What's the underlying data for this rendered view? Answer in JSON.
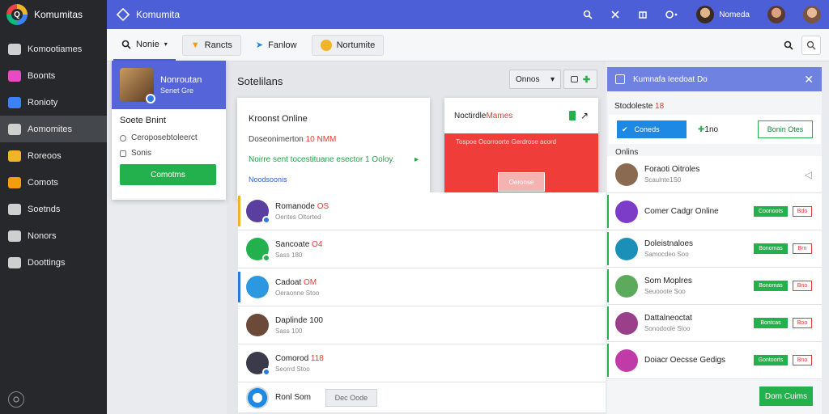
{
  "app": {
    "name": "Komumitas"
  },
  "sidebar": {
    "items": [
      {
        "label": "Komootiames",
        "icon": "home-icon",
        "color": "#cfcfcf"
      },
      {
        "label": "Boonts",
        "icon": "pink-app-icon",
        "color": "#e84bc1"
      },
      {
        "label": "Ronioty",
        "icon": "colorful-app-icon",
        "color": "#3b82f6"
      },
      {
        "label": "Aomomites",
        "icon": "list-icon",
        "color": "#cfcfcf"
      },
      {
        "label": "Roreoos",
        "icon": "colorful-app-icon",
        "color": "#f0b429"
      },
      {
        "label": "Comots",
        "icon": "colorful-app-icon",
        "color": "#f59e0b"
      },
      {
        "label": "Soetnds",
        "icon": "list-icon",
        "color": "#cfcfcf"
      },
      {
        "label": "Nonors",
        "icon": "circle-icon",
        "color": "#cfcfcf"
      },
      {
        "label": "Doottings",
        "icon": "gear-icon",
        "color": "#cfcfcf"
      }
    ],
    "active_index": 3
  },
  "topbar": {
    "title": "Komumita",
    "user_label": "Nomeda"
  },
  "tabs": [
    {
      "label": "Nonie",
      "icon": "search-icon"
    },
    {
      "label": "Rancts",
      "icon": "fox-icon"
    },
    {
      "label": "Fanlow",
      "icon": "bird-icon"
    },
    {
      "label": "Nortumite",
      "icon": "smile-icon"
    }
  ],
  "profile": {
    "name": "Nonroutan",
    "sub": "Senet Gre",
    "section_title": "Soete Bnint",
    "options": [
      "Ceroposebtoleerct",
      "Sonis"
    ],
    "button": "Comotms"
  },
  "main": {
    "title": "Sotelilans",
    "filter_value": "Onnos",
    "online_card": {
      "title": "Kroonst Online",
      "line_prefix": "Doseonimerton",
      "line_red": "10 NMM",
      "green_text": "Noirre sent tocestituane esector 1 Ooloy.",
      "blue_text": "Noodsoonis"
    },
    "notif_card": {
      "title_prefix": "Noctirdle",
      "title_red": "Mames",
      "sub": "Tospoe Ocorroorte Gerdrose acord",
      "button": "Oeronse"
    },
    "rows": [
      {
        "name": "Romanode",
        "name_red": "OS",
        "sub": "Oentes Oltorted",
        "avatar": "#5b3fa0",
        "status": "#2b79e0",
        "bar": "#f0b429"
      },
      {
        "name": "Sancoate",
        "name_red": "O4",
        "sub": "Sass 180",
        "avatar": "#22b14c",
        "status": "#22b14c",
        "bar": ""
      },
      {
        "name": "Cadoat",
        "name_red": "OM",
        "sub": "Oeraonne Stoo",
        "avatar": "#2b98e0",
        "status": "",
        "bar": "#2b79e0"
      },
      {
        "name": "Daplinde 100",
        "name_red": "",
        "sub": "Sass 100",
        "avatar": "#6b4a3a",
        "status": "",
        "bar": ""
      },
      {
        "name": "Comorod",
        "name_red": "118",
        "sub": "Seorrd Stoo",
        "avatar": "#3a3a4a",
        "status": "#2b79e0",
        "bar": ""
      }
    ],
    "footer": {
      "label": "Ronl Som",
      "button": "Dec Oode"
    }
  },
  "right": {
    "header": "Kumnafa Ieedoat Do",
    "title_prefix": "Stodoleste",
    "title_red": "18",
    "blue_button": "Coneds",
    "count": "1no",
    "outline_button": "Bonin Otes",
    "online_label": "Onlins",
    "rows": [
      {
        "name": "Foraoti Oitroles",
        "sub": "Scaulnte1S0",
        "avatar": "#8a6a50",
        "accept": "",
        "decline": ""
      },
      {
        "name": "Comer Cadgr Online",
        "sub": "",
        "avatar": "#7d3cc7",
        "accept": "Coonoots",
        "decline": "Bdo"
      },
      {
        "name": "Doleistnaloes",
        "sub": "Samocdeo Soo",
        "avatar": "#1a8fb8",
        "accept": "Bonomas",
        "decline": "Brn"
      },
      {
        "name": "Som Moplres",
        "sub": "Seuooote Soo",
        "avatar": "#5cab5c",
        "accept": "Bonomas",
        "decline": "Bno"
      },
      {
        "name": "Dattalneoctat",
        "sub": "Sonodoole Sloo",
        "avatar": "#9a3f8a",
        "accept": "Bontcas",
        "decline": "Boo"
      },
      {
        "name": "Doiacr Oecsse Gedigs",
        "sub": "",
        "avatar": "#c13ba8",
        "accept": "Gontoorts",
        "decline": "Bno"
      }
    ],
    "footer_button": "Dom Cuims"
  },
  "colors": {
    "brand": "#4c5fd6",
    "accent_green": "#22b14c",
    "accent_red": "#ef3e3a"
  }
}
